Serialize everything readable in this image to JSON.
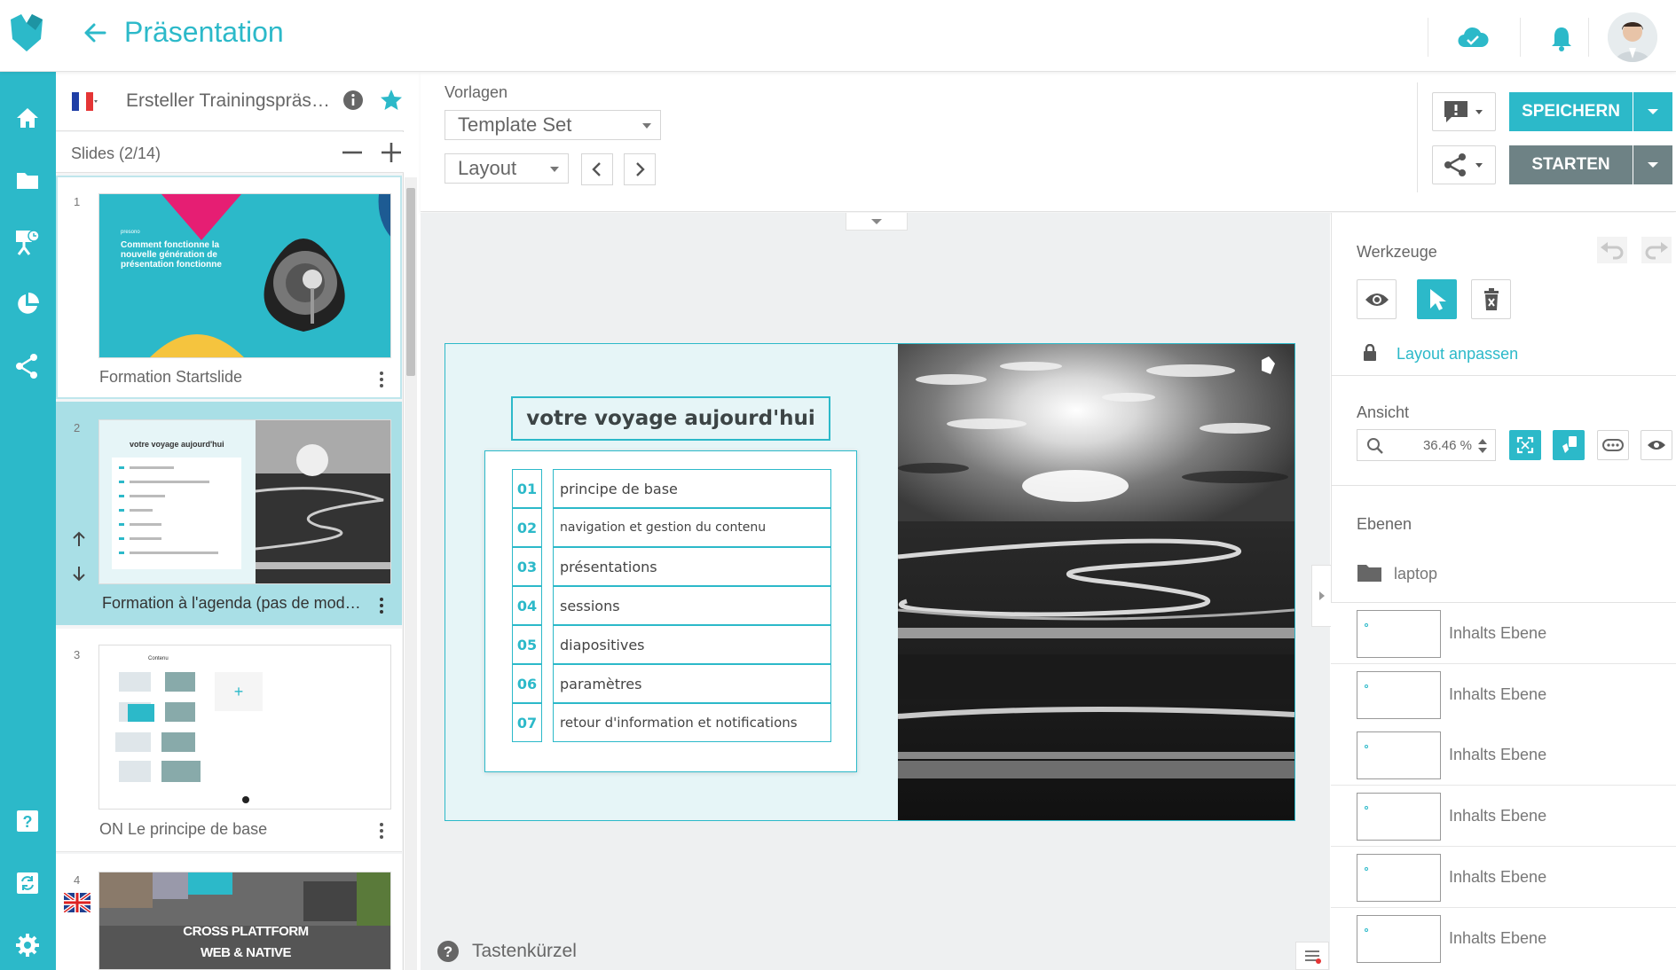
{
  "header": {
    "title": "Präsentation"
  },
  "slides_panel": {
    "presentation_title": "Ersteller Trainingspräse…",
    "slides_count": "Slides (2/14)",
    "slides": [
      {
        "number": "1",
        "label": "Formation Startslide",
        "thumb_text": "Comment fonctionne la nouvelle génération de présentation fonctionne",
        "thumb_brand": "presono"
      },
      {
        "number": "2",
        "label": "Formation à l'agenda (pas de modèl…",
        "thumb_title": "votre voyage aujourd'hui"
      },
      {
        "number": "3",
        "label": "ON Le principe de base",
        "thumb_title": "Contenu"
      },
      {
        "number": "4",
        "thumb_text1": "CROSS PLATTFORM",
        "thumb_text2": "WEB & NATIVE"
      }
    ]
  },
  "toolbar": {
    "vorlagen_label": "Vorlagen",
    "template_select": "Template Set",
    "layout_select": "Layout",
    "save_label": "SPEICHERN",
    "start_label": "STARTEN"
  },
  "slide": {
    "title": "votre voyage aujourd'hui",
    "items": [
      {
        "num": "01",
        "text": "principe de base"
      },
      {
        "num": "02",
        "text": "navigation et gestion du contenu"
      },
      {
        "num": "03",
        "text": "présentations"
      },
      {
        "num": "04",
        "text": "sessions"
      },
      {
        "num": "05",
        "text": "diapositives"
      },
      {
        "num": "06",
        "text": "paramètres"
      },
      {
        "num": "07",
        "text": "retour d'information et notifications"
      }
    ]
  },
  "canvas": {
    "shortcuts_label": "Tastenkürzel"
  },
  "right_panel": {
    "tools_label": "Werkzeuge",
    "layout_adjust": "Layout anpassen",
    "view_label": "Ansicht",
    "zoom_value": "36.46 %",
    "layers_label": "Ebenen",
    "folder_name": "laptop",
    "layers": [
      "Inhalts Ebene",
      "Inhalts Ebene",
      "Inhalts Ebene",
      "Inhalts Ebene",
      "Inhalts Ebene",
      "Inhalts Ebene"
    ]
  },
  "colors": {
    "accent": "#2cb9c9",
    "start_button": "#6e8285"
  },
  "icons": [
    "logo-icon",
    "back-arrow-icon",
    "cloud-check-icon",
    "bell-icon",
    "home-icon",
    "folder-icon",
    "presentation-icon",
    "pie-chart-icon",
    "share-icon",
    "help-icon",
    "sync-icon",
    "gear-icon",
    "info-icon",
    "star-icon",
    "minus-icon",
    "plus-icon",
    "kebab-icon",
    "arrow-up-icon",
    "arrow-down-icon",
    "comment-icon",
    "chevron-left-icon",
    "chevron-right-icon",
    "eye-icon",
    "cursor-icon",
    "delete-icon",
    "lock-icon",
    "undo-icon",
    "redo-icon",
    "search-icon",
    "fit-screen-icon",
    "touch-icon",
    "more-icon",
    "folder-icon"
  ]
}
